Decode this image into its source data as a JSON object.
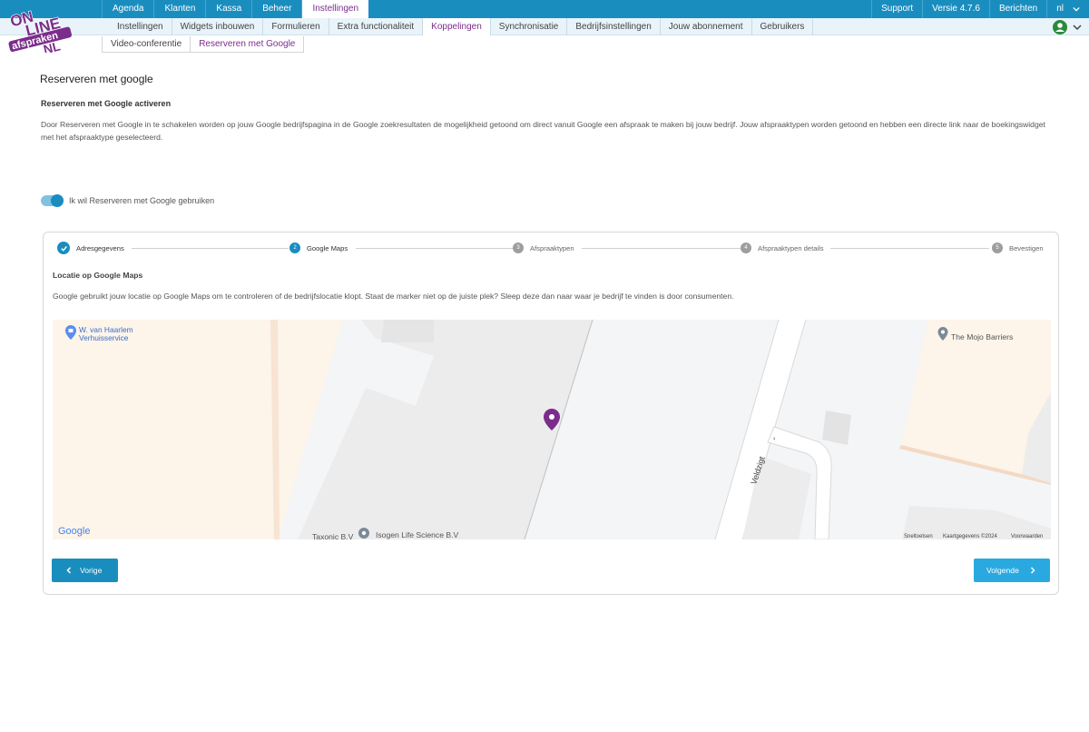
{
  "logo": {
    "text": "ONLINE afspraken.NL"
  },
  "topnav": {
    "items": [
      {
        "label": "Agenda"
      },
      {
        "label": "Klanten"
      },
      {
        "label": "Kassa"
      },
      {
        "label": "Beheer"
      },
      {
        "label": "Instellingen",
        "active": true
      }
    ],
    "right": [
      {
        "label": "Support"
      },
      {
        "label": "Versie 4.7.6"
      },
      {
        "label": "Berichten"
      },
      {
        "label": "nl"
      }
    ]
  },
  "subnav": {
    "items": [
      {
        "label": "Instellingen"
      },
      {
        "label": "Widgets inbouwen"
      },
      {
        "label": "Formulieren"
      },
      {
        "label": "Extra functionaliteit"
      },
      {
        "label": "Koppelingen",
        "active": true
      },
      {
        "label": "Synchronisatie"
      },
      {
        "label": "Bedrijfsinstellingen"
      },
      {
        "label": "Jouw abonnement"
      },
      {
        "label": "Gebruikers"
      }
    ]
  },
  "subsubnav": {
    "items": [
      {
        "label": "Video-conferentie"
      },
      {
        "label": "Reserveren met Google",
        "active": true
      }
    ]
  },
  "page": {
    "title": "Reserveren met google",
    "section_title": "Reserveren met Google activeren",
    "description": "Door Reserveren met Google in te schakelen worden op jouw Google bedrijfspagina in de Google zoekresultaten de mogelijkheid getoond om direct vanuit Google een afspraak te maken bij jouw bedrijf. Jouw afspraaktypen worden getoond en hebben een directe link naar de boekingswidget met het afspraaktype geselecteerd.",
    "toggle_label": "Ik wil Reserveren met Google gebruiken",
    "toggle_on": true
  },
  "wizard": {
    "steps": [
      {
        "number": "1",
        "label": "Adresgegevens",
        "state": "done"
      },
      {
        "number": "2",
        "label": "Google Maps",
        "state": "active"
      },
      {
        "number": "3",
        "label": "Afspraaktypen",
        "state": "pending"
      },
      {
        "number": "4",
        "label": "Afspraaktypen details",
        "state": "pending"
      },
      {
        "number": "5",
        "label": "Bevestigen",
        "state": "pending"
      }
    ],
    "location_title": "Locatie op Google Maps",
    "location_desc": "Google gebruikt jouw locatie op Google Maps om te controleren of de bedrijfslocatie klopt. Staat de marker niet op de juiste plek? Sleep deze dan naar waar je bedrijf te vinden is door consumenten.",
    "prev_label": "Vorige",
    "next_label": "Volgende"
  },
  "map": {
    "poi_1_line1": "W. van Haarlem",
    "poi_1_line2": "Verhuisservice",
    "poi_2": "The Mojo Barriers",
    "poi_3": "Isogen Life Science B.V",
    "poi_4": "Taxonic B.V",
    "street": "Veldzigt",
    "google_logo": "Google",
    "attr_shortcuts": "Sneltoetsen",
    "attr_data": "Kaartgegevens ©2024",
    "attr_terms": "Voorwaarden"
  },
  "colors": {
    "primary": "#1a8dbf",
    "accent": "#7b2d8b",
    "marker": "#7b2d8b"
  }
}
